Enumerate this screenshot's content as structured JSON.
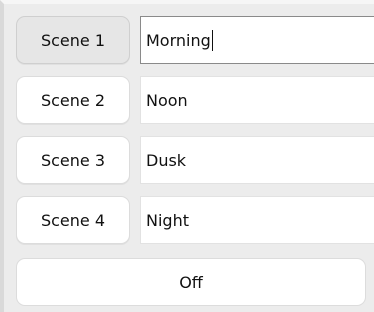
{
  "scenes": [
    {
      "button_label": "Scene 1",
      "name_value": "Morning",
      "selected": true,
      "focused": true
    },
    {
      "button_label": "Scene 2",
      "name_value": "Noon",
      "selected": false,
      "focused": false
    },
    {
      "button_label": "Scene 3",
      "name_value": "Dusk",
      "selected": false,
      "focused": false
    },
    {
      "button_label": "Scene 4",
      "name_value": "Night",
      "selected": false,
      "focused": false
    }
  ],
  "off_button": {
    "label": "Off"
  },
  "colors": {
    "panel_background": "#ececec",
    "button_background": "#ffffff",
    "selected_button_background": "#e6e6e6",
    "focus_border": "#8a8a8a"
  }
}
